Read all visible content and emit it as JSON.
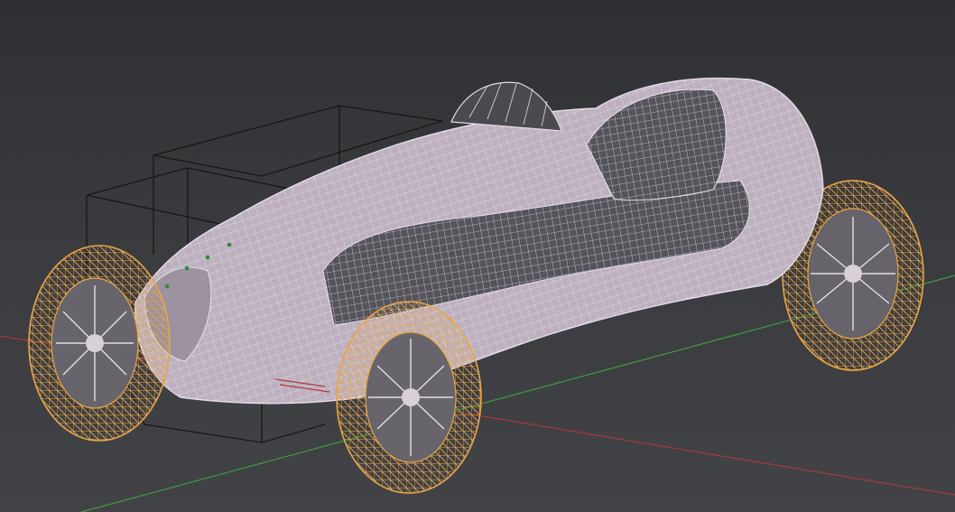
{
  "viewport": {
    "kind": "3d-viewport",
    "shading": "wireframe",
    "show_floor_axes": true
  },
  "colors": {
    "background_top": "#2f3033",
    "background_bottom": "#424347",
    "body_wire": "#d9cfd9",
    "body_fill": "#bfb3c1",
    "selected_wire": "#e8a547",
    "camera_frame": "#111111",
    "axis_x": "#b23a3a",
    "axis_y": "#3f9a3f",
    "vertex_dot": "#2e8b3a"
  },
  "objects": [
    {
      "name": "car-body",
      "selected": false
    },
    {
      "name": "front-left-wheel",
      "selected": true
    },
    {
      "name": "front-right-wheel",
      "selected": true
    },
    {
      "name": "rear-left-wheel",
      "selected": true
    },
    {
      "name": "rear-right-wheel",
      "selected": true
    },
    {
      "name": "empty-box",
      "selected": false
    }
  ]
}
